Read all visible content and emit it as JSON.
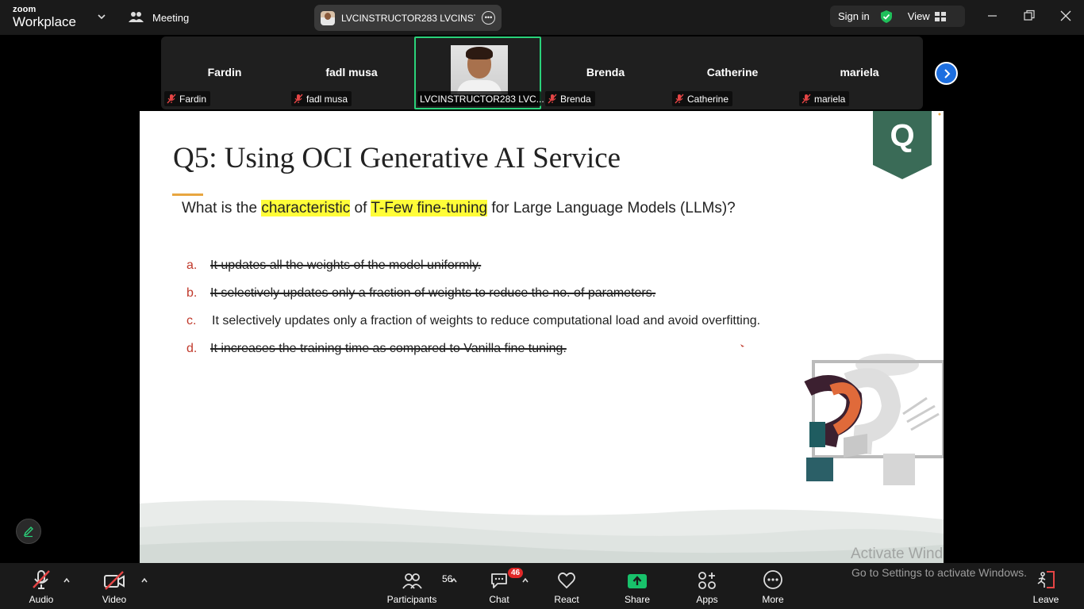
{
  "app": {
    "logo_top": "zoom",
    "logo_bottom": "Workplace",
    "meeting_menu_label": "Meeting",
    "meeting_tab_title": "LVCINSTRUCTOR283 LVCINSTRUC",
    "sign_in_label": "Sign in",
    "view_label": "View"
  },
  "gallery": {
    "tiles": [
      {
        "display_name": "Fardin",
        "tag": "Fardin",
        "muted": true
      },
      {
        "display_name": "fadl musa",
        "tag": "fadl musa",
        "muted": true
      },
      {
        "display_name": "",
        "tag": "LVCINSTRUCTOR283 LVC...",
        "muted": false,
        "active": true
      },
      {
        "display_name": "Brenda",
        "tag": "Brenda",
        "muted": true
      },
      {
        "display_name": "Catherine",
        "tag": "Catherine",
        "muted": true
      },
      {
        "display_name": "mariela",
        "tag": "mariela",
        "muted": true
      }
    ]
  },
  "slide": {
    "title": "Q5: Using OCI Generative AI Service",
    "badge_letter": "Q",
    "question_parts": {
      "p1": "What is the ",
      "h1": "characteristic",
      "p2": " of ",
      "h2": "T-Few fine-tuning",
      "p3": " for Large Language Models (LLMs)?"
    },
    "answers": [
      {
        "letter": "a.",
        "text": "It updates all the weights of the model uniformly. ",
        "struck": true
      },
      {
        "letter": "b.",
        "text": "It selectively updates only a fraction of weights to reduce the no. of parameters. ",
        "struck": true
      },
      {
        "letter": "c.",
        "text": "It selectively updates only a fraction of weights to reduce computational load and avoid overfitting.",
        "struck": false
      },
      {
        "letter": "d.",
        "text": "It increases the training time as compared to Vanilla fine tuning. ",
        "struck": true
      }
    ],
    "watermark_line1": "Activate Windows",
    "watermark_line2": "Go to Settings to activate Windows."
  },
  "toolbar": {
    "audio_label": "Audio",
    "video_label": "Video",
    "participants_label": "Participants",
    "participants_count": "56",
    "chat_label": "Chat",
    "chat_badge": "46",
    "react_label": "React",
    "share_label": "Share",
    "apps_label": "Apps",
    "more_label": "More",
    "leave_label": "Leave"
  },
  "colors": {
    "active_tile_border": "#2ad27a",
    "share_green": "#18c26b",
    "highlight_yellow": "#fffd38",
    "answer_letter_red": "#c0392b",
    "badge_green": "#3a6b57",
    "next_button_blue": "#1d6fe0"
  }
}
